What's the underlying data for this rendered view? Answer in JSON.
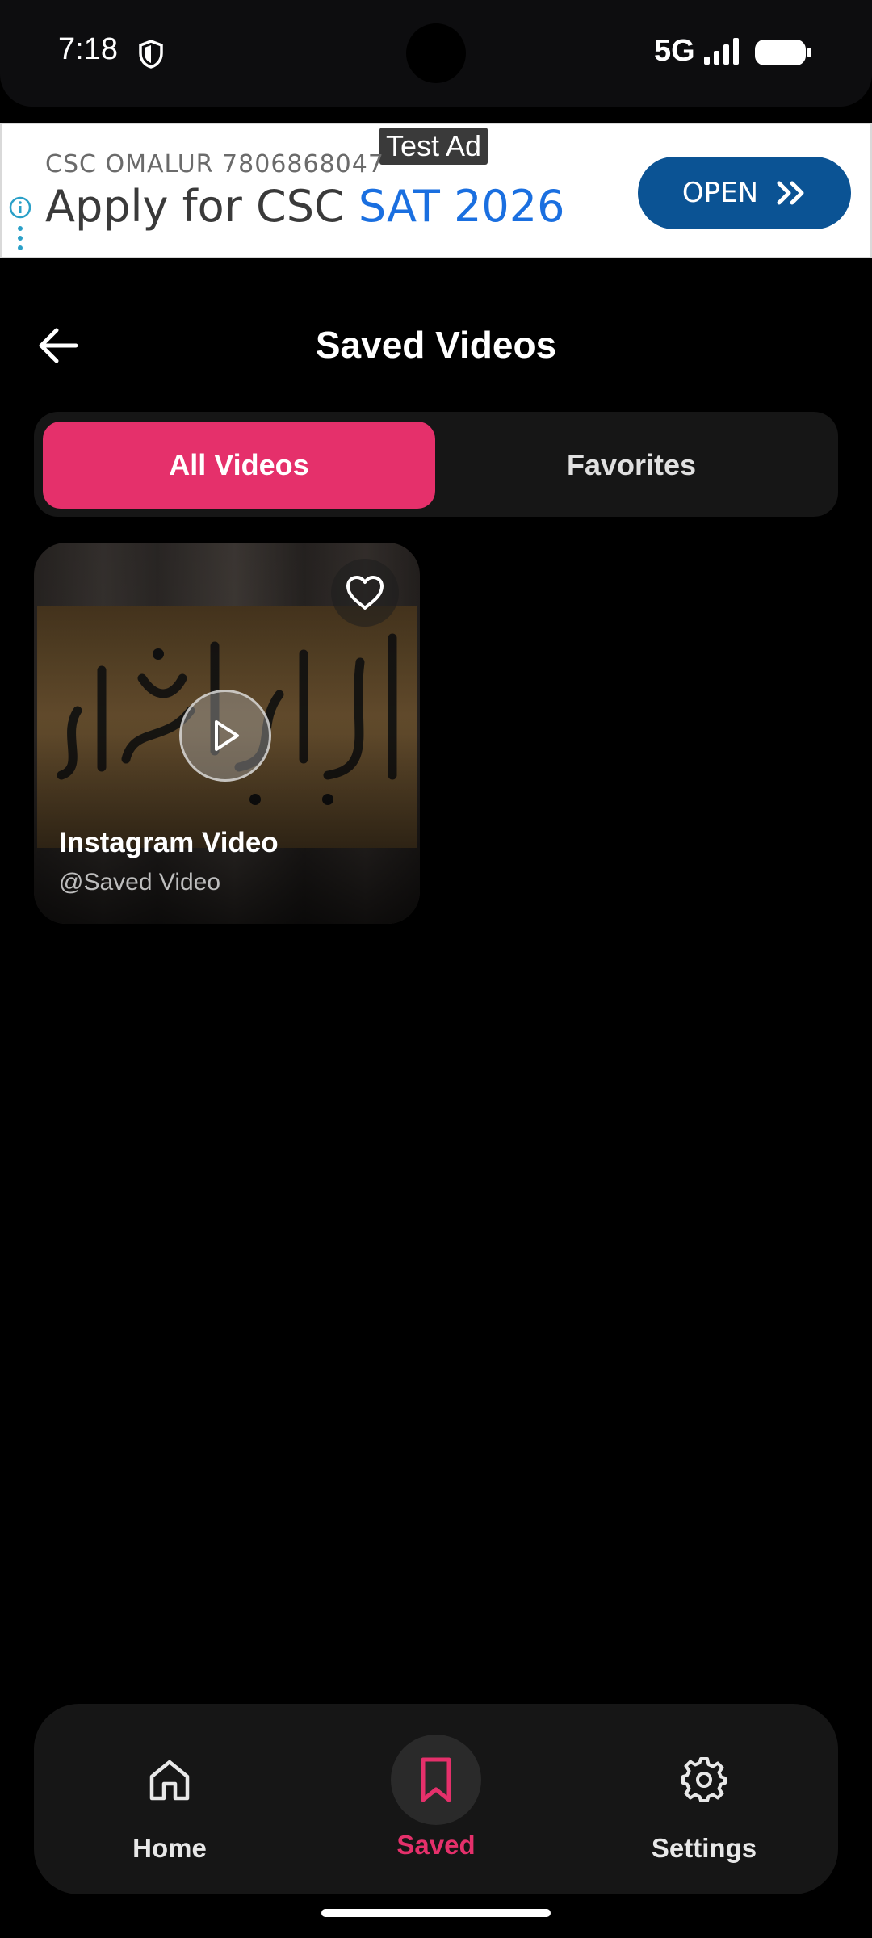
{
  "status_bar": {
    "time": "7:18",
    "network": "5G",
    "icons": [
      "shield-icon",
      "signal-icon",
      "battery-icon"
    ]
  },
  "ad": {
    "tag": "Test Ad",
    "sponsor": "CSC OMALUR 7806868047",
    "headline_prefix": "Apply for CSC ",
    "headline_highlight": "SAT 2026",
    "cta": "OPEN",
    "icons": [
      "info-icon",
      "double-chevron-right-icon"
    ]
  },
  "header": {
    "title": "Saved Videos",
    "back_icon": "arrow-left-icon"
  },
  "tabs": [
    {
      "label": "All Videos",
      "active": true
    },
    {
      "label": "Favorites",
      "active": false
    }
  ],
  "videos": [
    {
      "title": "Instagram Video",
      "subtitle": "@Saved Video",
      "favorited": false
    }
  ],
  "bottom_nav": {
    "items": [
      {
        "label": "Home",
        "icon": "home-icon",
        "active": false
      },
      {
        "label": "Saved",
        "icon": "bookmark-icon",
        "active": true
      },
      {
        "label": "Settings",
        "icon": "gear-icon",
        "active": false
      }
    ]
  },
  "colors": {
    "accent": "#e5306b",
    "background": "#000000",
    "surface": "#161616",
    "ad_button": "#0b5394",
    "ad_highlight": "#1a6fe0"
  }
}
